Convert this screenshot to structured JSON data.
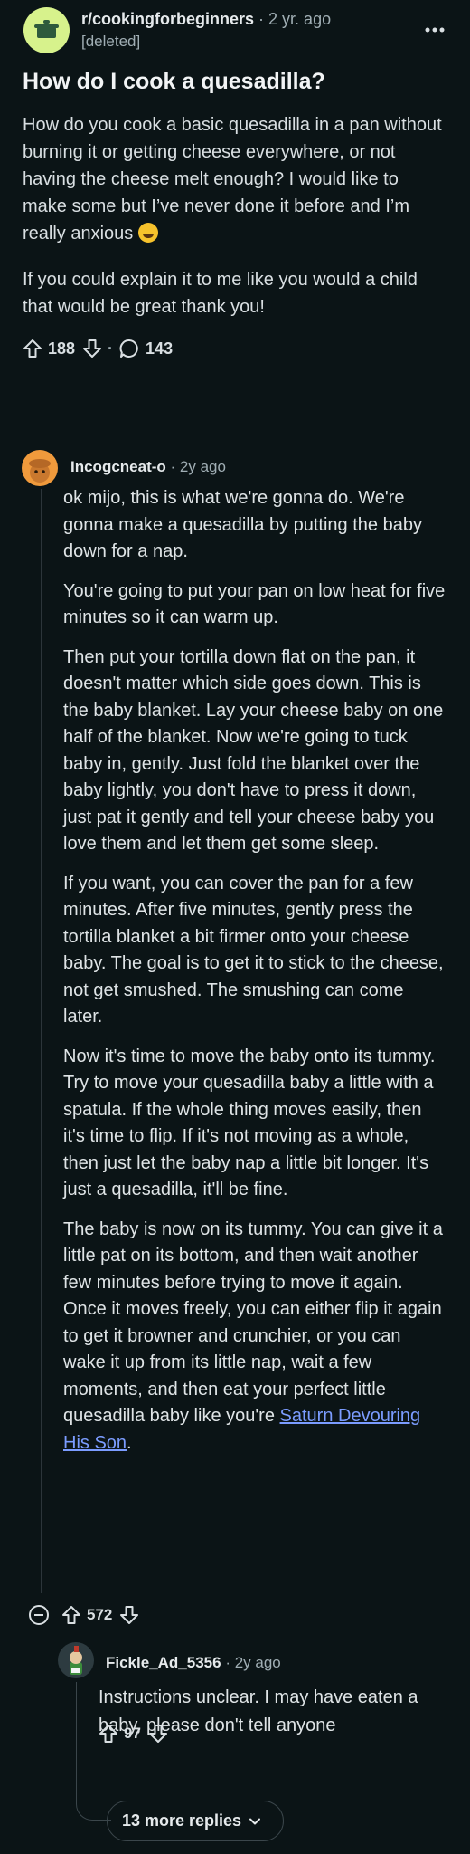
{
  "post": {
    "subreddit": "r/cookingforbeginners",
    "time": "2 yr. ago",
    "author": "[deleted]",
    "title": "How do I cook a quesadilla?",
    "body": [
      "How do you cook a basic quesadilla in a pan without burning it or getting cheese everywhere, or not having the cheese melt enough? I would like to make some but I’ve never done it before and I’m really anxious",
      "If you could explain it to me like you would a child that would be great thank you!"
    ],
    "upvotes": "188",
    "comments": "143"
  },
  "comment1": {
    "username": "Incogcneat-o",
    "time": "2y ago",
    "paragraphs": [
      "ok mijo, this is what we're gonna do. We're gonna make a quesadilla by putting the baby down for a nap.",
      "You're going to put your pan on low heat for five minutes so it can warm up.",
      "Then put your tortilla down flat on the pan, it doesn't matter which side goes down. This is the baby blanket. Lay your cheese baby on one half of the blanket. Now we're going to tuck baby in, gently. Just fold the blanket over the baby lightly, you don't have to press it down, just pat it gently and tell your cheese baby you love them and let them get some sleep.",
      "If you want, you can cover the pan for a few minutes. After five minutes, gently press the tortilla blanket a bit firmer onto your cheese baby. The goal is to get it to stick to the cheese, not get smushed. The smushing can come later.",
      "Now it's time to move the baby onto its tummy. Try to move your quesadilla baby a little with a spatula. If the whole thing moves easily, then it's time to flip. If it's not moving as a whole, then just let the baby nap a little bit longer. It's just a quesadilla, it'll be fine."
    ],
    "last_paragraph": "The baby is now on its tummy. You can give it a little pat on its bottom, and then wait another few minutes before trying to move it again. Once it moves freely, you can either flip it again to get it browner and crunchier, or you can wake it up from its little nap, wait a few moments, and then eat your perfect little quesadilla baby like you're",
    "link_text": "Saturn Devouring His Son",
    "link_suffix": ".",
    "upvotes": "572"
  },
  "comment2": {
    "username": "Fickle_Ad_5356",
    "time": "2y ago",
    "text": "Instructions unclear. I may have eaten a baby, please don't tell anyone",
    "upvotes": "97"
  },
  "more_replies": "13 more replies",
  "icons": {
    "overflow": "more-horizontal-icon",
    "upvote": "arrow-up-icon",
    "downvote": "arrow-down-icon",
    "comment": "speech-bubble-icon",
    "collapse": "collapse-minus-icon",
    "expand": "chevron-down-icon"
  },
  "colors": {
    "background": "#0b1416",
    "link": "#7b9cff",
    "subreddit_avatar": "#d7f28c"
  }
}
